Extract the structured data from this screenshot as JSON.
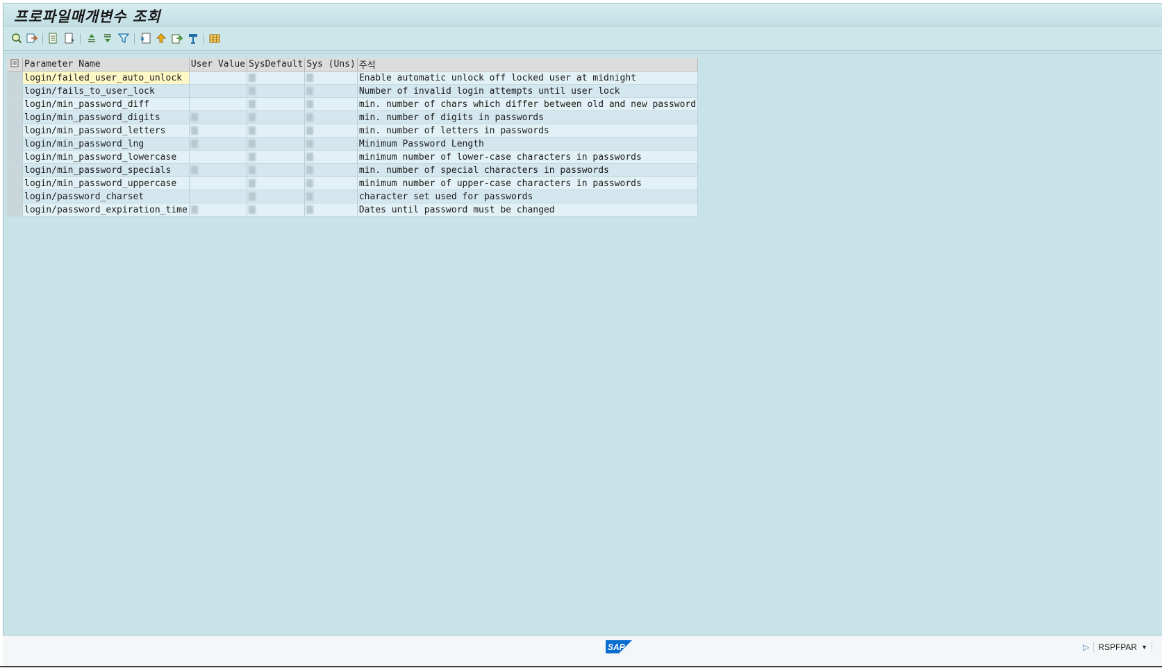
{
  "window": {
    "title": "프로파일매개변수 조회"
  },
  "toolbar": {
    "icons": [
      "details-icon",
      "select-detail-icon",
      "first-page-icon",
      "page-icon",
      "sort-ascending-icon",
      "sort-descending-icon",
      "filter-icon",
      "sum-icon",
      "subtotal-icon",
      "export-icon",
      "print-icon",
      "layout-grid-icon"
    ]
  },
  "table": {
    "columns": [
      "Parameter Name",
      "User Value",
      "SysDefault",
      "Sys (Uns)",
      "주석"
    ],
    "rows": [
      {
        "name": "login/failed_user_auto_unlock",
        "comment": "Enable automatic unlock off locked user at midnight"
      },
      {
        "name": "login/fails_to_user_lock",
        "comment": "Number of invalid login attempts until user lock"
      },
      {
        "name": "login/min_password_diff",
        "comment": "min. number of chars which differ between old and new password"
      },
      {
        "name": "login/min_password_digits",
        "comment": "min. number of digits in passwords"
      },
      {
        "name": "login/min_password_letters",
        "comment": "min. number of letters in passwords"
      },
      {
        "name": "login/min_password_lng",
        "comment": "Minimum Password Length"
      },
      {
        "name": "login/min_password_lowercase",
        "comment": "minimum number of lower-case characters in passwords"
      },
      {
        "name": "login/min_password_specials",
        "comment": "min. number of special characters in passwords"
      },
      {
        "name": "login/min_password_uppercase",
        "comment": "minimum number of upper-case characters in passwords"
      },
      {
        "name": "login/password_charset",
        "comment": "character set used for passwords"
      },
      {
        "name": "login/password_expiration_time",
        "comment": "Dates until password must be changed"
      }
    ]
  },
  "statusbar": {
    "logo": "SAP",
    "transaction": "RSPFPAR"
  },
  "colors": {
    "background": "#c8e3e8",
    "row_even": "#e2f1f5",
    "row_odd": "#d4e6ee",
    "highlight": "#fef7c6",
    "sap_blue": "#0a6ed1"
  }
}
